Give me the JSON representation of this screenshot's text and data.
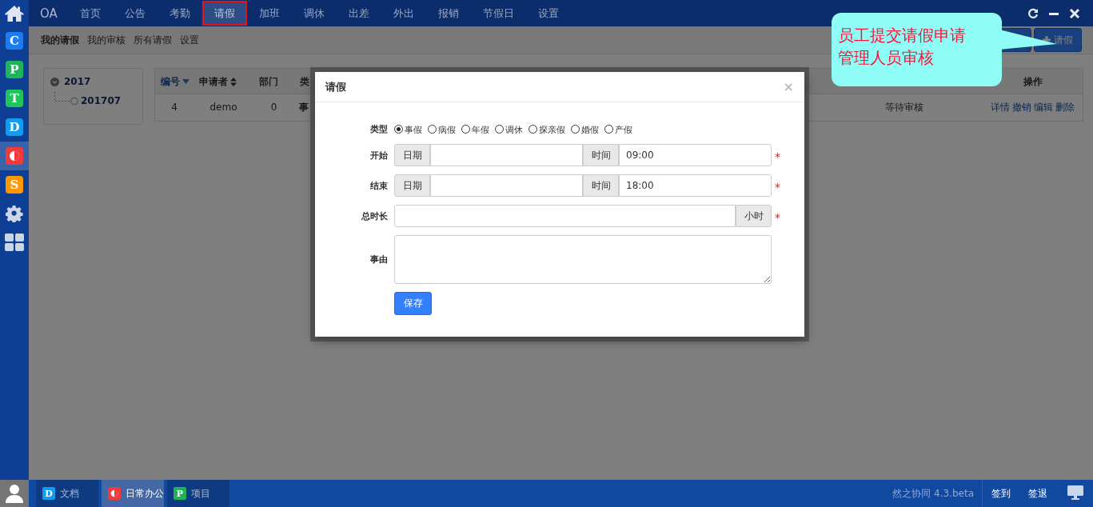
{
  "top_nav": {
    "brand": "OA",
    "tabs": [
      {
        "label": "首页",
        "selected": false
      },
      {
        "label": "公告",
        "selected": false
      },
      {
        "label": "考勤",
        "selected": false
      },
      {
        "label": "请假",
        "selected": true
      },
      {
        "label": "加班",
        "selected": false
      },
      {
        "label": "调休",
        "selected": false
      },
      {
        "label": "出差",
        "selected": false
      },
      {
        "label": "外出",
        "selected": false
      },
      {
        "label": "报销",
        "selected": false
      },
      {
        "label": "节假日",
        "selected": false
      },
      {
        "label": "设置",
        "selected": false
      }
    ]
  },
  "sidebar": {
    "items": [
      {
        "kind": "app",
        "letter": "C",
        "color": "#1e7cf2",
        "selected": false
      },
      {
        "kind": "app",
        "letter": "P",
        "color": "#1fb45a",
        "selected": false
      },
      {
        "kind": "app",
        "letter": "T",
        "color": "#1fc45a",
        "selected": false
      },
      {
        "kind": "app",
        "letter": "D",
        "color": "#119cf0",
        "selected": false
      },
      {
        "kind": "half",
        "color": "#f23a3a",
        "selected": true
      },
      {
        "kind": "app",
        "letter": "S",
        "color": "#ff9800",
        "selected": false
      },
      {
        "kind": "gear"
      },
      {
        "kind": "grid"
      }
    ]
  },
  "sub_nav": {
    "items": [
      {
        "label": "我的请假",
        "selected": true
      },
      {
        "label": "我的审核",
        "selected": false
      },
      {
        "label": "所有请假",
        "selected": false
      },
      {
        "label": "设置",
        "selected": false
      }
    ],
    "buttons": [
      {
        "kind": "plain"
      },
      {
        "kind": "add",
        "label": "请假"
      }
    ]
  },
  "tree": [
    {
      "label": "2017",
      "expanded": true,
      "children": [
        {
          "label": "201707"
        }
      ]
    }
  ],
  "table": {
    "columns": [
      {
        "label": "编号",
        "kind": "sorted"
      },
      {
        "label": "申请者",
        "kind": "sortable"
      },
      {
        "label": "部门",
        "kind": "plain"
      },
      {
        "label": "类",
        "kind": "plain"
      },
      {
        "label": "操作"
      }
    ],
    "rows": [
      {
        "cells": [
          "4",
          "demo",
          "0",
          "事"
        ],
        "status": "等待审核",
        "actions": [
          "详情",
          "撤销",
          "编辑",
          "删除"
        ]
      }
    ]
  },
  "dialog": {
    "title": "请假",
    "close": "×",
    "type_label": "类型",
    "types": [
      {
        "label": "事假",
        "selected": true
      },
      {
        "label": "病假",
        "selected": false
      },
      {
        "label": "年假",
        "selected": false
      },
      {
        "label": "调休",
        "selected": false
      },
      {
        "label": "探亲假",
        "selected": false
      },
      {
        "label": "婚假",
        "selected": false
      },
      {
        "label": "产假",
        "selected": false
      }
    ],
    "fields": [
      {
        "kind": "datetime",
        "label": "开始",
        "date_addon": "日期",
        "time_addon": "时间",
        "time": "09:00",
        "mark": "*"
      },
      {
        "kind": "datetime",
        "label": "结束",
        "date_addon": "日期",
        "time_addon": "时间",
        "time": "18:00",
        "mark": "*"
      },
      {
        "kind": "hours",
        "label": "总时长",
        "addon": "小时",
        "mark": "*"
      },
      {
        "kind": "text",
        "label": "事由"
      }
    ],
    "save": "保存"
  },
  "callout": {
    "lines": [
      "员工提交请假申请",
      "管理人员审核"
    ]
  },
  "taskbar": {
    "tasks": [
      {
        "label": "文档",
        "kind": "app",
        "letter": "D",
        "color": "#119cf0",
        "selected": false
      },
      {
        "label": "日常办公",
        "kind": "half",
        "color": "#f23a3a",
        "selected": true
      },
      {
        "label": "项目",
        "kind": "app",
        "letter": "P",
        "color": "#1fb45a",
        "selected": false
      }
    ],
    "version": "然之协同 4.3.beta",
    "links": [
      "签到",
      "签退"
    ]
  }
}
